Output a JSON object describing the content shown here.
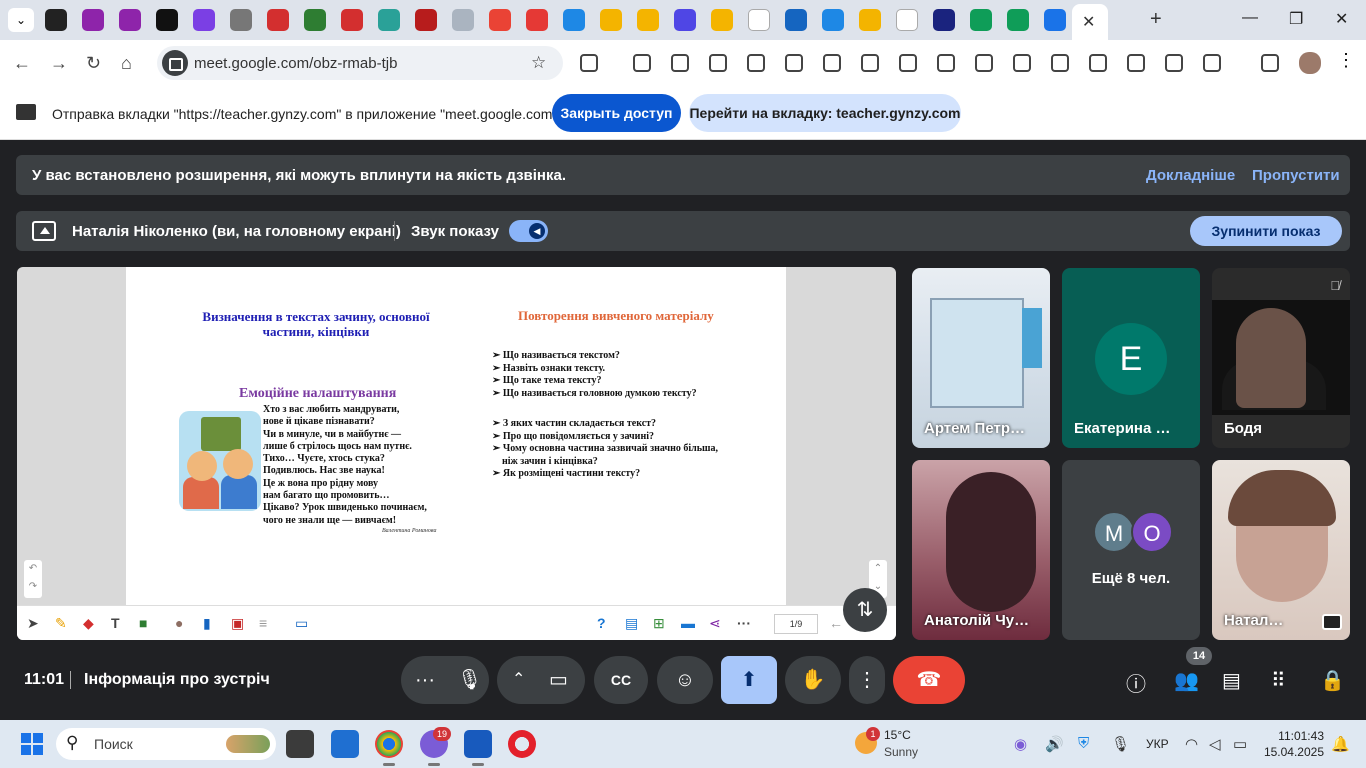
{
  "browser": {
    "tab_close_label": "✕",
    "new_tab_label": "+",
    "tab_icon_colors": [
      "#222222",
      "#8e24aa",
      "#8e24aa",
      "#111111",
      "#7b3fe4",
      "#777777",
      "#d32f2f",
      "#2e7d32",
      "#d32f2f",
      "#2aa198",
      "#b71c1c",
      "#aab4c0",
      "#ea4335",
      "#e53935",
      "#1e88e5",
      "#f4b400",
      "#f4b400",
      "#4f46e5",
      "#f4b400",
      "#ffffff",
      "#1565c0",
      "#1e88e5",
      "#f4b400",
      "#ffffff",
      "#1a237e",
      "#0f9d58",
      "#0f9d58",
      "#1a73e8",
      "#1a237e"
    ],
    "window_controls": [
      "—",
      "❐",
      "✕"
    ],
    "nav": {
      "back": "←",
      "forward": "→",
      "reload": "↻",
      "home": "⌂"
    },
    "url": "meet.google.com/obz-rmab-tjb",
    "bookmark_icon": "☆"
  },
  "infobar": {
    "message": "Отправка вкладки \"https://teacher.gynzy.com\" в приложение \"meet.google.com\"...",
    "stop_button": "Закрыть доступ",
    "goto_button": "Перейти на вкладку: teacher.gynzy.com"
  },
  "meet": {
    "warning": {
      "text": "У вас встановлено розширення, які можуть вплинути на якість дзвінка.",
      "learn_more": "Докладніше",
      "skip": "Пропустити"
    },
    "presenting": {
      "name": "Наталія Ніколенко (ви, на головному екрані)",
      "sound_label": "Звук показу",
      "stop_button": "Зупинити показ"
    },
    "slide": {
      "heading_left": "Визначення в текстах зачину, основної частини, кінцівки",
      "heading_right": "Повторення вивченого матеріалу",
      "heading_mood": "Емоційне налаштування",
      "poem": [
        "Хто з вас любить мандрувати,",
        "нове й цікаве пізнавати?",
        "Чи в минуле, чи в майбутнє —",
        "лише б стрілось щось нам путнє.",
        "Тихо… Чуєте, хтось стука?",
        "Подивлюсь. Нас зве наука!",
        "Це ж вона про рідну мову",
        "нам багато що промовить…",
        "Цікаво? Урок швиденько починаєм,",
        "чого не знали ще — вивчаєм!"
      ],
      "author": "Валентина Романова",
      "questions_1": [
        "➢ Що називається текстом?",
        "➢ Назвіть ознаки тексту.",
        "➢ Що таке тема тексту?",
        "➢ Що називається головною думкою тексту?"
      ],
      "questions_2": [
        "➢ З яких частин складається текст?",
        "➢ Про що повідомляється у зачині?",
        "➢ Чому основна частина зазвичай значно більша,",
        "    ніж зачин і кінцівка?",
        "➢ Як розміщені частини тексту?"
      ],
      "page_indicator": "1/9"
    },
    "tiles": {
      "t1": "Артем Петр…",
      "t2": "Екатерина …",
      "t2_avatar": "Е",
      "t3": "Бодя",
      "t4": "Анатолій Чу…",
      "t5_avatar_1": "М",
      "t5_avatar_2": "О",
      "t5_more": "Ещё 8 чел.",
      "t6": "Натал…"
    },
    "bottom": {
      "time": "11:01",
      "meeting_info": "Інформація про зустріч",
      "participants_count": "14"
    }
  },
  "taskbar": {
    "search_placeholder": "Поиск",
    "app_badge": "19",
    "weather_badge": "1",
    "temperature": "15°C",
    "condition": "Sunny",
    "language": "УКР",
    "clock_time": "11:01:43",
    "clock_date": "15.04.2025"
  }
}
